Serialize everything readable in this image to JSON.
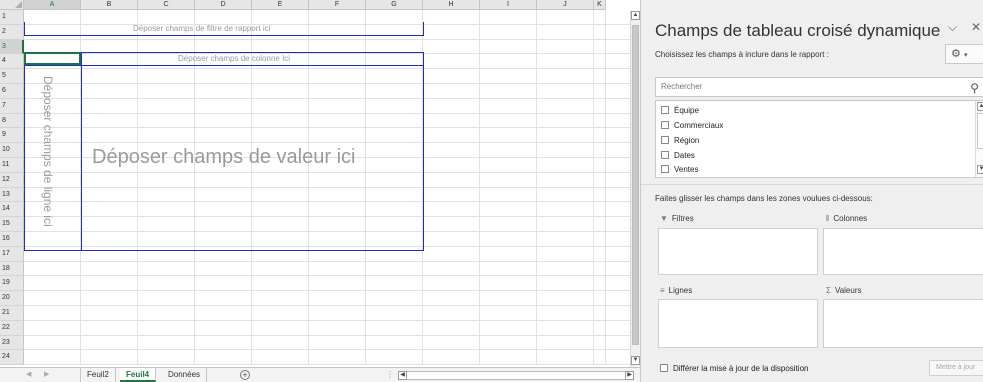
{
  "sheet": {
    "columns": [
      "A",
      "B",
      "C",
      "D",
      "E",
      "F",
      "G",
      "H",
      "I",
      "J",
      "K"
    ],
    "selected_column": "A",
    "rows": [
      "1",
      "2",
      "3",
      "4",
      "5",
      "6",
      "7",
      "8",
      "9",
      "10",
      "11",
      "12",
      "13",
      "14",
      "15",
      "16",
      "17",
      "18",
      "19",
      "20",
      "21",
      "22",
      "23",
      "24"
    ],
    "selected_row": "3",
    "pivot_placeholders": {
      "report_filter": "Déposer champs de filtre de rapport ici",
      "column": "Déposer champs de colonne Ici",
      "values": "Déposer champs de valeur ici",
      "row": "Déposer champs de ligne ici"
    },
    "tabs": [
      {
        "label": "Feuil2",
        "active": false
      },
      {
        "label": "Feuil4",
        "active": true
      },
      {
        "label": "Données",
        "active": false
      }
    ],
    "add_sheet_icon": "plus-circle-icon"
  },
  "pane": {
    "title": "Champs de tableau croisé dynamique",
    "subtitle": "Choisissez les champs à inclure dans le rapport :",
    "search_placeholder": "Rechercher",
    "fields": [
      {
        "label": "Équipe",
        "checked": false
      },
      {
        "label": "Commerciaux",
        "checked": false
      },
      {
        "label": "Région",
        "checked": false
      },
      {
        "label": "Dates",
        "checked": false
      },
      {
        "label": "Ventes",
        "checked": false
      }
    ],
    "drag_hint": "Faites glisser les champs dans les zones voulues ci-dessous:",
    "areas": {
      "filters": "Filtres",
      "columns": "Colonnes",
      "rows": "Lignes",
      "values": "Valeurs"
    },
    "defer_label": "Différer la mise à jour de la disposition",
    "update_label": "Mettre à jour"
  },
  "colors": {
    "excel_green": "#217346",
    "pivot_border": "#1f2cbf",
    "placeholder_text": "#9a9a9a"
  }
}
